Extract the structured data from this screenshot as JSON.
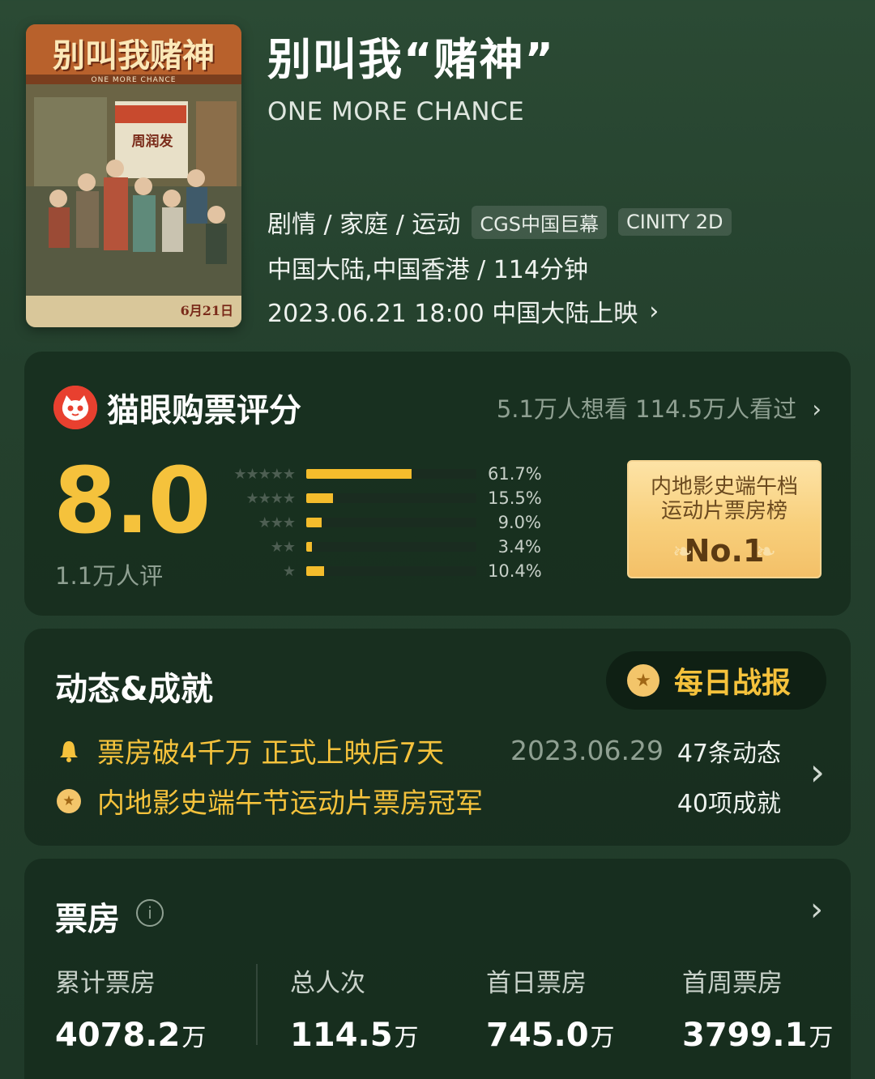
{
  "movie": {
    "title": "别叫我“赌神”",
    "english_title": "ONE MORE CHANCE",
    "genres": "剧情 / 家庭 / 运动",
    "tags": [
      "CGS中国巨幕",
      "CINITY 2D"
    ],
    "region_runtime": "中国大陆,中国香港 / 114分钟",
    "release": "2023.06.21 18:00 中国大陆上映"
  },
  "rating": {
    "section_title": "猫眼购票评分",
    "audience_line": "5.1万人想看 114.5万人看过",
    "score": "8.0",
    "rating_count": "1.1万人评",
    "distribution": [
      {
        "stars": 5,
        "percent": 61.7,
        "label": "61.7%"
      },
      {
        "stars": 4,
        "percent": 15.5,
        "label": "15.5%"
      },
      {
        "stars": 3,
        "percent": 9.0,
        "label": "9.0%"
      },
      {
        "stars": 2,
        "percent": 3.4,
        "label": "3.4%"
      },
      {
        "stars": 1,
        "percent": 10.4,
        "label": "10.4%"
      }
    ],
    "badge": {
      "line1": "内地影史端午档",
      "line2": "运动片票房榜",
      "rank": "No.1"
    }
  },
  "news": {
    "section_title": "动态&成就",
    "daily_button": "每日战报",
    "headline": "票房破4千万 正式上映后7天",
    "headline_date": "2023.06.29",
    "updates_count": "47条动态",
    "achievement": "内地影史端午节运动片票房冠军",
    "achievements_count": "40项成就"
  },
  "box_office": {
    "section_title": "票房",
    "stats": [
      {
        "label": "累计票房",
        "value": "4078.2",
        "unit": "万"
      },
      {
        "label": "总人次",
        "value": "114.5",
        "unit": "万"
      },
      {
        "label": "首日票房",
        "value": "745.0",
        "unit": "万"
      },
      {
        "label": "首周票房",
        "value": "3799.1",
        "unit": "万"
      }
    ]
  },
  "poster": {
    "title_text": "别叫我赌神",
    "subtitle_text": "ONE MORE CHANCE",
    "sign_text": "周润发",
    "date_text": "6月21日"
  },
  "icons": {
    "maoyan_logo": "maoyan-cat-logo",
    "chevron": "chevron-right-icon",
    "bell": "bell-icon",
    "medal": "medal-icon",
    "info": "info-icon"
  },
  "colors": {
    "accent_gold": "#f5c23c",
    "background_green": "#24402d",
    "muted_text": "#8fa092"
  }
}
